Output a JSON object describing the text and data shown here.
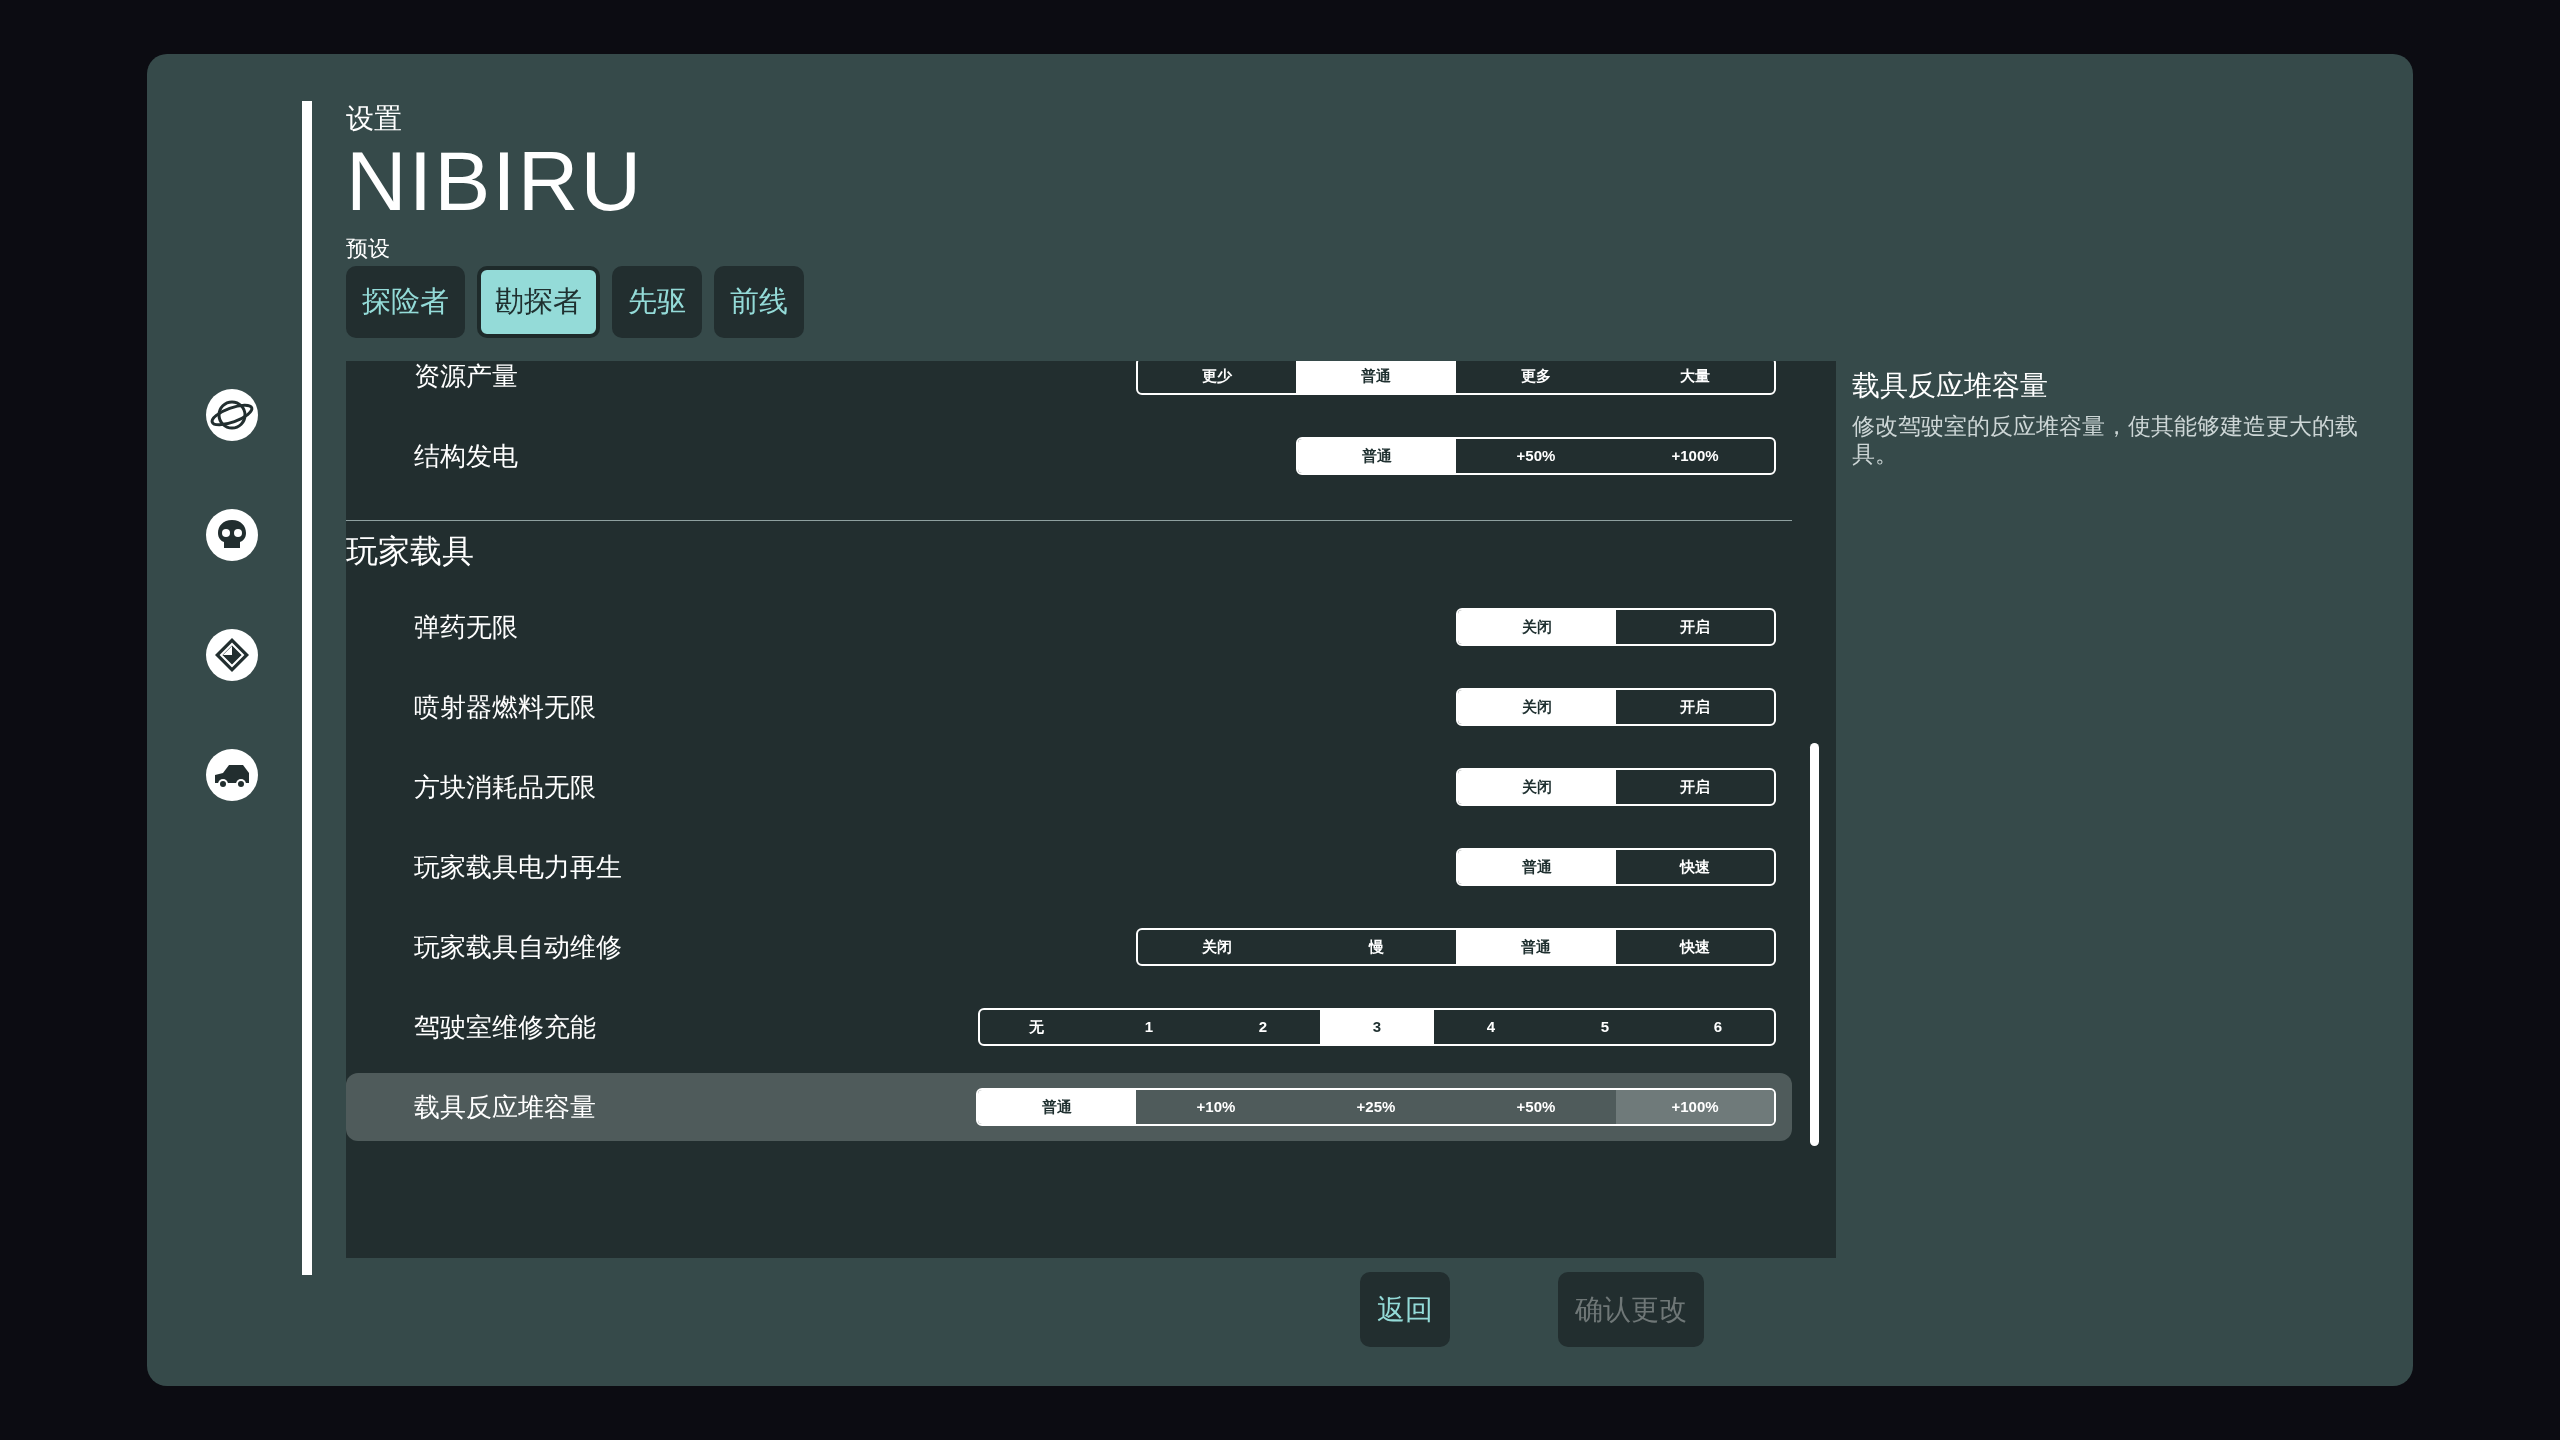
{
  "header": {
    "subtitle": "设置",
    "title": "NIBIRU",
    "presets_label": "预设"
  },
  "presets": [
    {
      "label": "探险者",
      "selected": false
    },
    {
      "label": "勘探者",
      "selected": true
    },
    {
      "label": "先驱",
      "selected": false
    },
    {
      "label": "前线",
      "selected": false
    }
  ],
  "settings": [
    {
      "kind": "option",
      "label": "资源产量",
      "highlighted": false,
      "options": [
        {
          "label": "更少",
          "selected": false,
          "hovered": false
        },
        {
          "label": "普通",
          "selected": true,
          "hovered": false
        },
        {
          "label": "更多",
          "selected": false,
          "hovered": false
        },
        {
          "label": "大量",
          "selected": false,
          "hovered": false
        }
      ]
    },
    {
      "kind": "option",
      "label": "结构发电",
      "highlighted": false,
      "options": [
        {
          "label": "普通",
          "selected": true,
          "hovered": false
        },
        {
          "label": "+50%",
          "selected": false,
          "hovered": false
        },
        {
          "label": "+100%",
          "selected": false,
          "hovered": false
        }
      ]
    },
    {
      "kind": "section",
      "label": "玩家载具"
    },
    {
      "kind": "option",
      "label": "弹药无限",
      "highlighted": false,
      "options": [
        {
          "label": "关闭",
          "selected": true,
          "hovered": false
        },
        {
          "label": "开启",
          "selected": false,
          "hovered": false
        }
      ]
    },
    {
      "kind": "option",
      "label": "喷射器燃料无限",
      "highlighted": false,
      "options": [
        {
          "label": "关闭",
          "selected": true,
          "hovered": false
        },
        {
          "label": "开启",
          "selected": false,
          "hovered": false
        }
      ]
    },
    {
      "kind": "option",
      "label": "方块消耗品无限",
      "highlighted": false,
      "options": [
        {
          "label": "关闭",
          "selected": true,
          "hovered": false
        },
        {
          "label": "开启",
          "selected": false,
          "hovered": false
        }
      ]
    },
    {
      "kind": "option",
      "label": "玩家载具电力再生",
      "highlighted": false,
      "options": [
        {
          "label": "普通",
          "selected": true,
          "hovered": false
        },
        {
          "label": "快速",
          "selected": false,
          "hovered": false
        }
      ]
    },
    {
      "kind": "option",
      "label": "玩家载具自动维修",
      "highlighted": false,
      "options": [
        {
          "label": "关闭",
          "selected": false,
          "hovered": false
        },
        {
          "label": "慢",
          "selected": false,
          "hovered": false
        },
        {
          "label": "普通",
          "selected": true,
          "hovered": false
        },
        {
          "label": "快速",
          "selected": false,
          "hovered": false
        }
      ]
    },
    {
      "kind": "option",
      "label": "驾驶室维修充能",
      "highlighted": false,
      "options": [
        {
          "label": "无",
          "selected": false,
          "hovered": false
        },
        {
          "label": "1",
          "selected": false,
          "hovered": false
        },
        {
          "label": "2",
          "selected": false,
          "hovered": false
        },
        {
          "label": "3",
          "selected": true,
          "hovered": false
        },
        {
          "label": "4",
          "selected": false,
          "hovered": false
        },
        {
          "label": "5",
          "selected": false,
          "hovered": false
        },
        {
          "label": "6",
          "selected": false,
          "hovered": false
        }
      ]
    },
    {
      "kind": "option",
      "label": "载具反应堆容量",
      "highlighted": true,
      "options": [
        {
          "label": "普通",
          "selected": true,
          "hovered": false
        },
        {
          "label": "+10%",
          "selected": false,
          "hovered": false
        },
        {
          "label": "+25%",
          "selected": false,
          "hovered": false
        },
        {
          "label": "+50%",
          "selected": false,
          "hovered": false
        },
        {
          "label": "+100%",
          "selected": false,
          "hovered": true
        }
      ]
    }
  ],
  "description": {
    "title": "载具反应堆容量",
    "text": "修改驾驶室的反应堆容量，使其能够建造更大的载具。"
  },
  "buttons": [
    {
      "label": "返回",
      "disabled": false
    },
    {
      "label": "确认更改",
      "disabled": true
    }
  ]
}
